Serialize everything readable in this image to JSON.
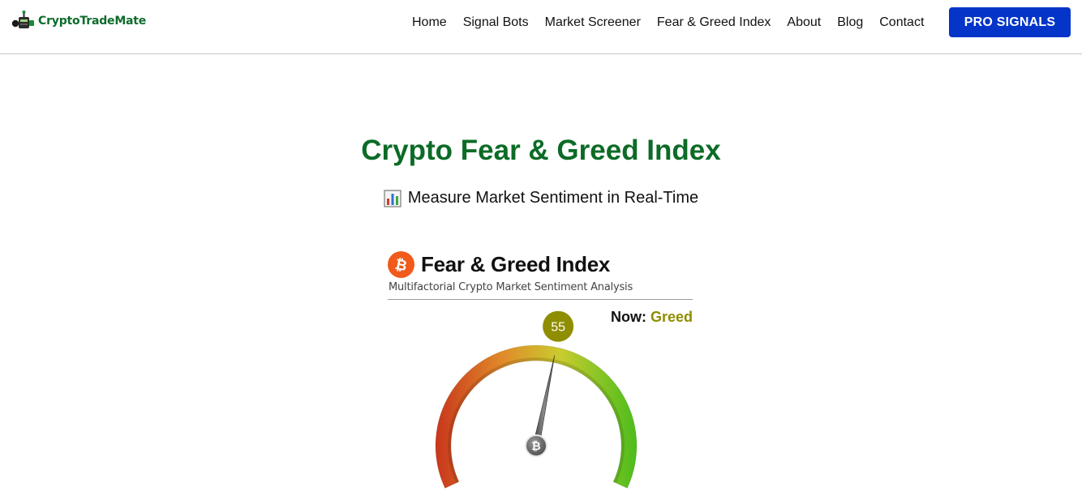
{
  "brand": {
    "name": "CryptoTradeMate",
    "color": "#0e6b2b",
    "icon": "robot-logo-icon"
  },
  "nav": {
    "items": [
      {
        "label": "Home"
      },
      {
        "label": "Signal Bots"
      },
      {
        "label": "Market Screener"
      },
      {
        "label": "Fear & Greed Index"
      },
      {
        "label": "About"
      },
      {
        "label": "Blog"
      },
      {
        "label": "Contact"
      }
    ],
    "cta_label": "PRO SIGNALS",
    "cta_color": "#0435c8"
  },
  "hero": {
    "title": "Crypto Fear & Greed Index",
    "title_color": "#0c6b26",
    "subtitle": "Measure Market Sentiment in Real-Time",
    "subtitle_icon": "bar-chart-emoji-icon"
  },
  "widget": {
    "title": "Fear & Greed Index",
    "subtitle": "Multifactorial Crypto Market Sentiment Analysis",
    "now_label": "Now:",
    "now_value": "Greed",
    "now_color": "#8f8d00",
    "gauge": {
      "value": 55,
      "min": 0,
      "max": 100,
      "badge_color": "#8f8d00",
      "scale_colors": [
        "#c8361c",
        "#e08a2a",
        "#c9cc2e",
        "#4cbd1d"
      ]
    }
  }
}
